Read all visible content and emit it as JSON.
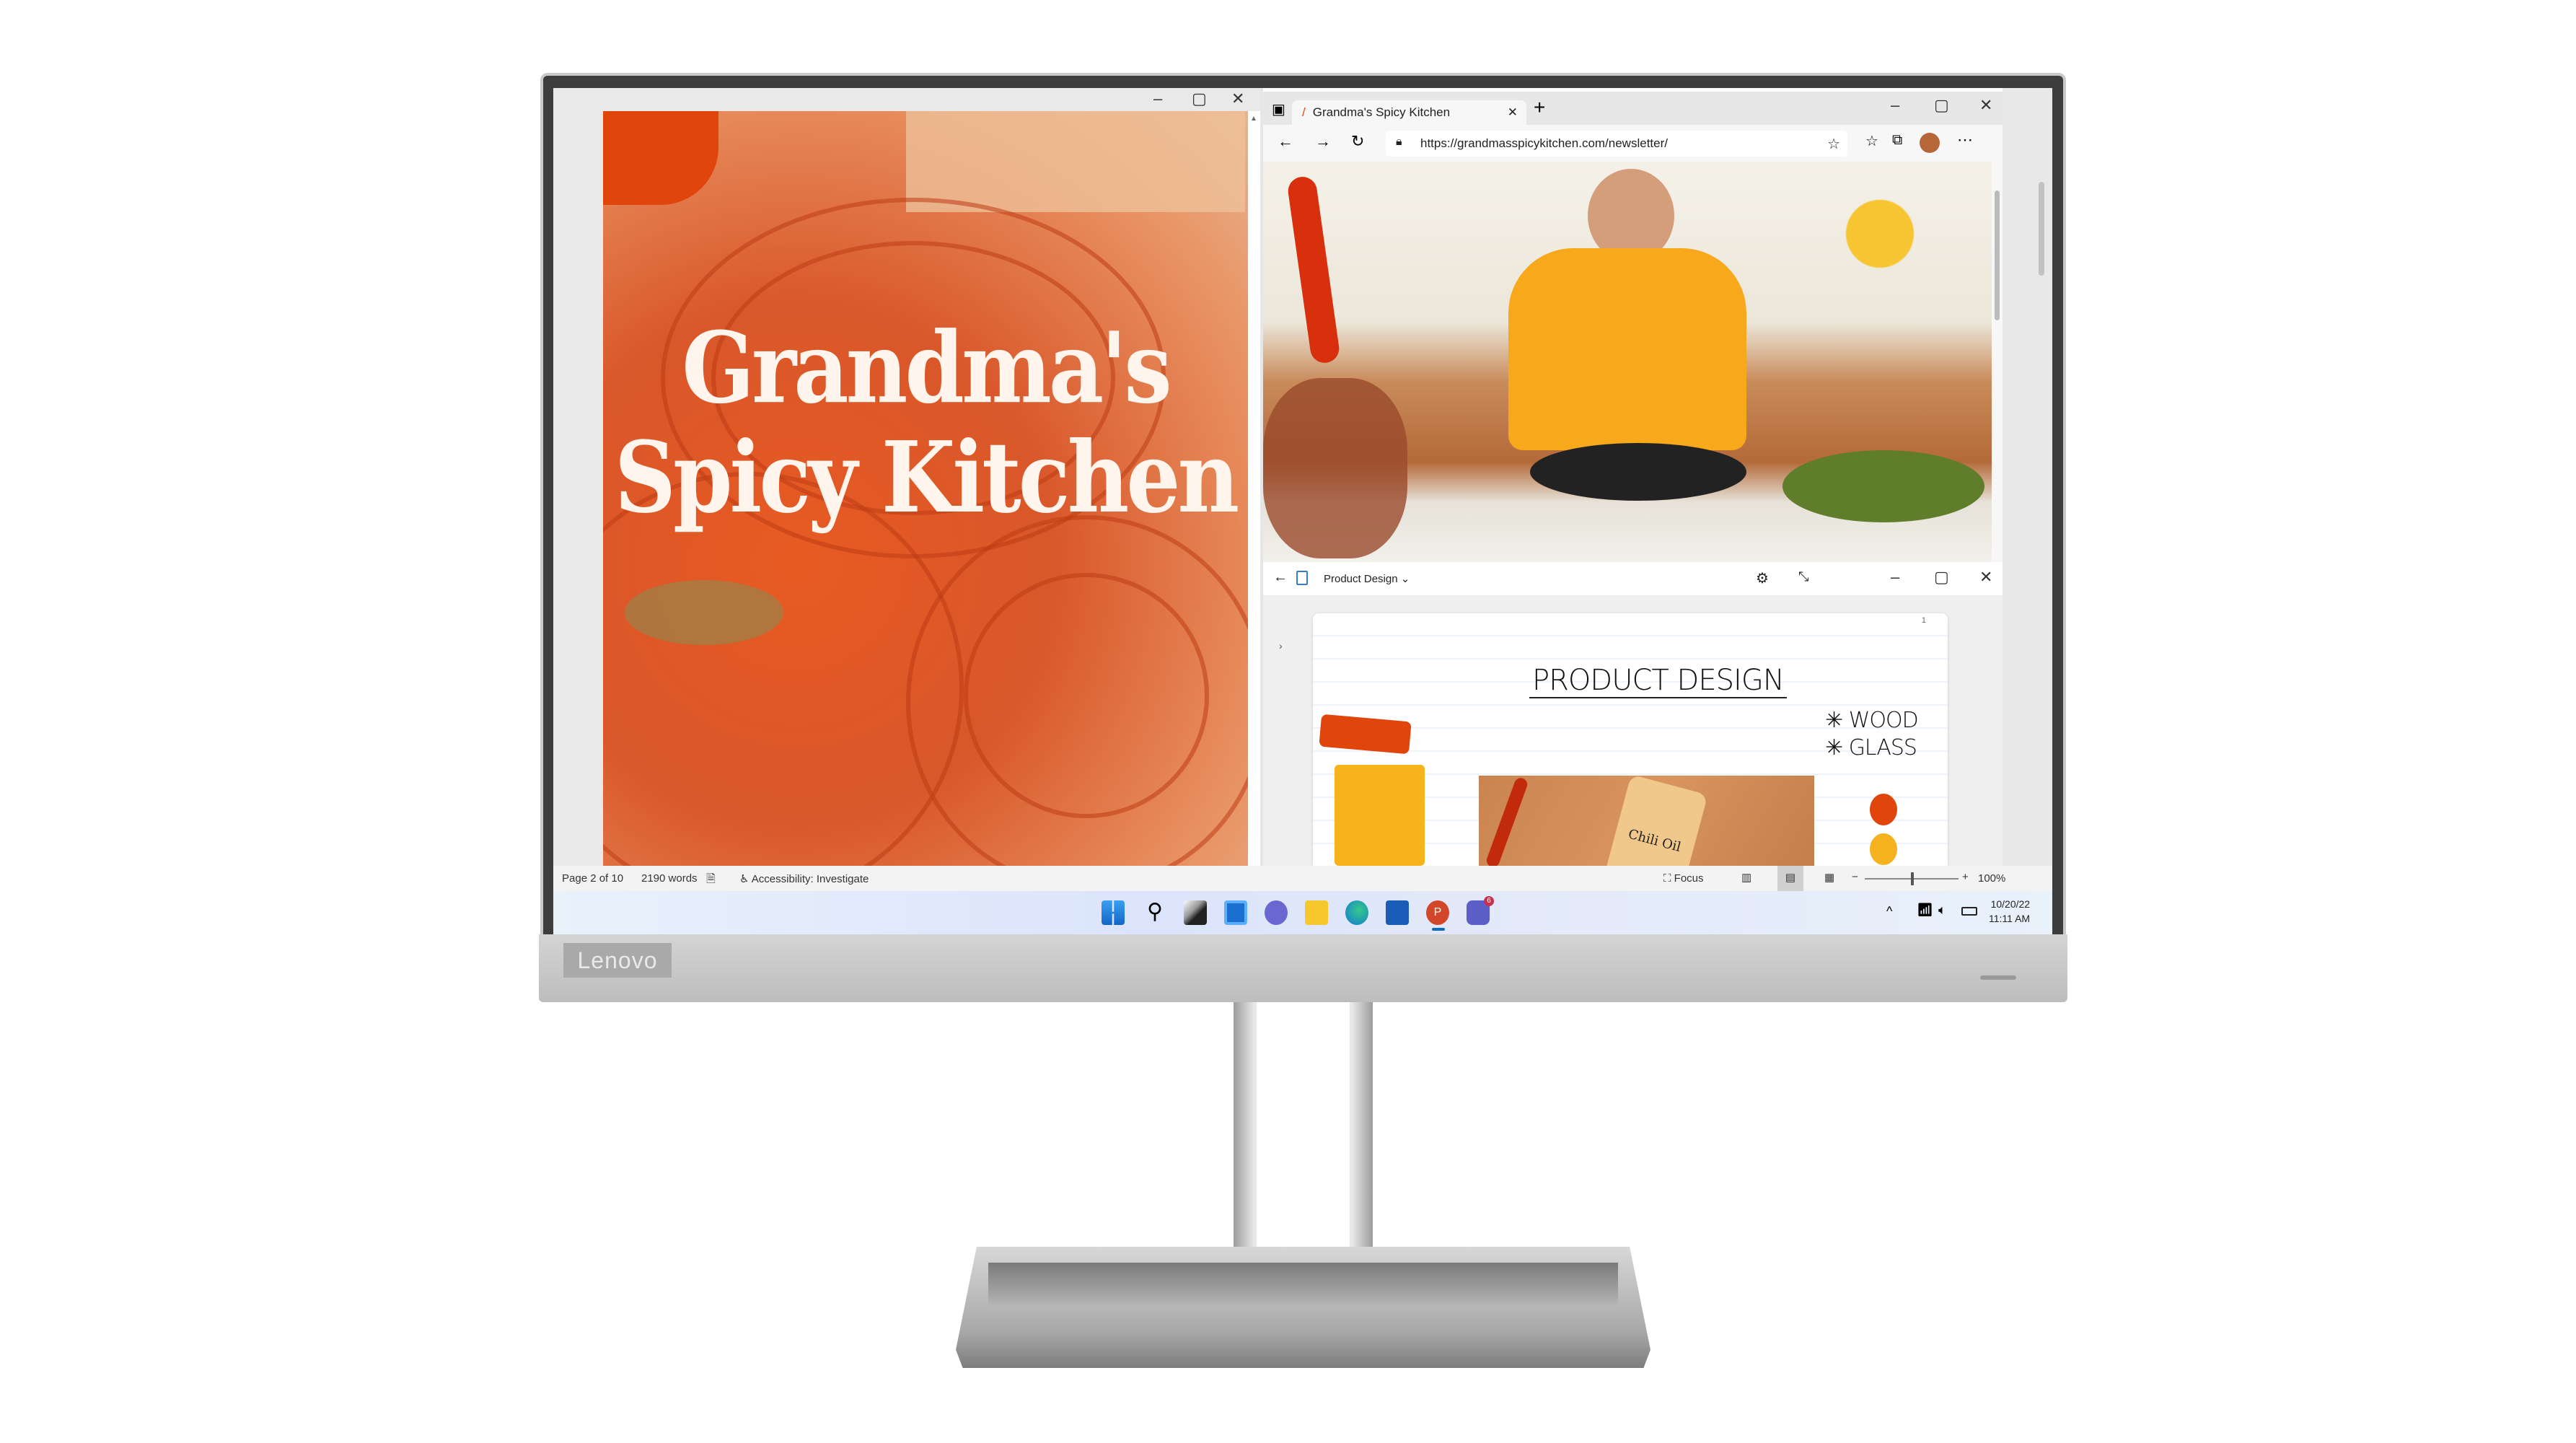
{
  "device": {
    "brand": "Lenovo"
  },
  "word": {
    "doc_title_line1": "Grandma's",
    "doc_title_line2": "Spicy Kitchen",
    "status": {
      "page": "Page 2 of 10",
      "words": "2190 words",
      "accessibility": "Accessibility: Investigate",
      "focus": "Focus",
      "zoom": "100%",
      "zoom_level_percent": 100
    }
  },
  "edge": {
    "tab_title": "Grandma's Spicy Kitchen",
    "url": "https://grandmasspicykitchen.com/newsletter/"
  },
  "whiteboard": {
    "title": "Product Design",
    "page_number": "1",
    "heading": "PRODUCT DESIGN",
    "notes": [
      "WOOD",
      "GLASS"
    ],
    "product_label": "Chili Oil",
    "swatch_colors": [
      "#e0450c",
      "#f5b21f"
    ]
  },
  "taskbar": {
    "apps": [
      "start",
      "search",
      "task-view",
      "widgets",
      "chat",
      "file-explorer",
      "edge",
      "store",
      "powerpoint",
      "teams"
    ],
    "teams_badge": "6",
    "date": "10/20/22",
    "time": "11:11 AM"
  },
  "colors": {
    "accent": "#0f6cbd",
    "orange": "#e0450c"
  }
}
